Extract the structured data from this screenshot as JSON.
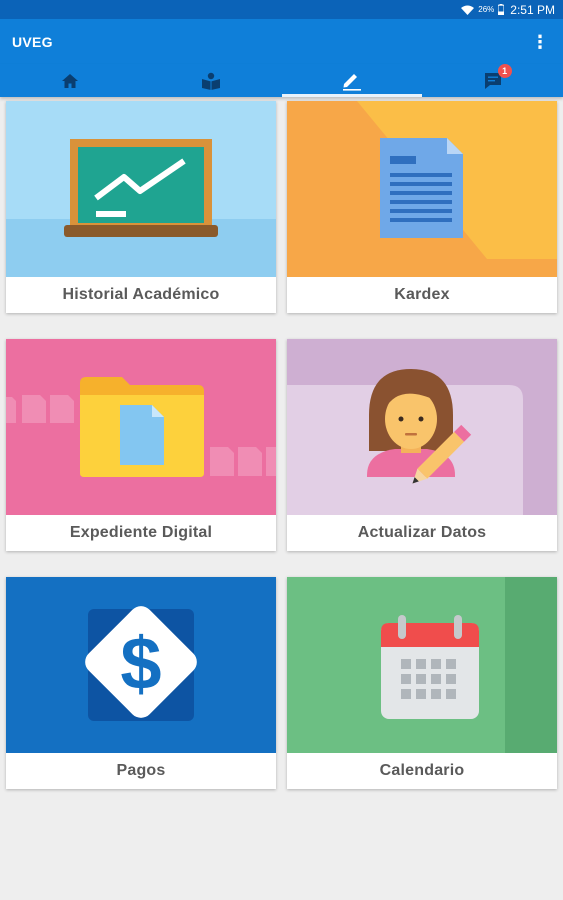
{
  "status_bar": {
    "battery_percent": "26%",
    "time": "2:51 PM",
    "icons": [
      "wifi-icon",
      "battery-icon"
    ]
  },
  "app_bar": {
    "title": "UVEG",
    "menu_icon": "overflow-menu-icon"
  },
  "tabs": [
    {
      "icon": "home-icon",
      "active": false
    },
    {
      "icon": "book-icon",
      "active": false
    },
    {
      "icon": "pencil-icon",
      "active": true
    },
    {
      "icon": "chat-icon",
      "active": false,
      "badge": "1"
    }
  ],
  "cards": [
    {
      "label": "Historial Académico",
      "icon": "chalkboard-chart-icon",
      "color": "#a7dcf7"
    },
    {
      "label": "Kardex",
      "icon": "document-icon",
      "color": "#f7a748"
    },
    {
      "label": "Expediente Digital",
      "icon": "folder-icon",
      "color": "#ec6fa0"
    },
    {
      "label": "Actualizar Datos",
      "icon": "user-edit-icon",
      "color": "#ceafd2"
    },
    {
      "label": "Pagos",
      "icon": "dollar-icon",
      "color": "#1470c2"
    },
    {
      "label": "Calendario",
      "icon": "calendar-icon",
      "color": "#6cbf83"
    }
  ]
}
